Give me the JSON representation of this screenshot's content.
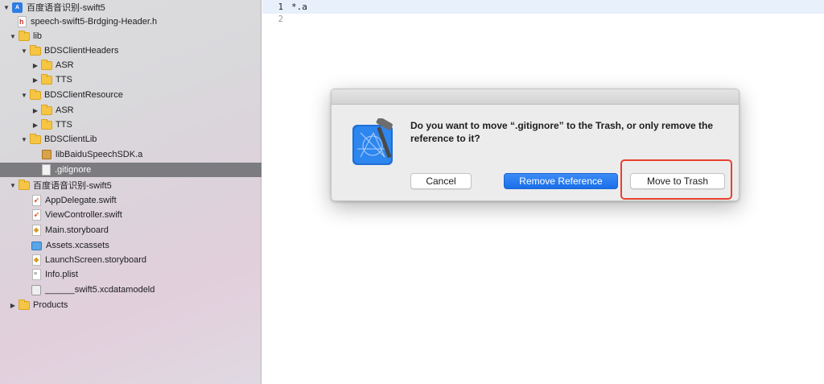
{
  "navigator": {
    "items": [
      {
        "label": "百度语音识别-swift5",
        "icon": "project-icon",
        "disclosure": "expanded"
      },
      {
        "label": "speech-swift5-Brdging-Header.h",
        "icon": "header-file-icon",
        "disclosure": "none"
      },
      {
        "label": "lib",
        "icon": "folder-icon",
        "disclosure": "expanded"
      },
      {
        "label": "BDSClientHeaders",
        "icon": "folder-icon",
        "disclosure": "expanded"
      },
      {
        "label": "ASR",
        "icon": "folder-icon",
        "disclosure": "collapsed"
      },
      {
        "label": "TTS",
        "icon": "folder-icon",
        "disclosure": "collapsed"
      },
      {
        "label": "BDSClientResource",
        "icon": "folder-icon",
        "disclosure": "expanded"
      },
      {
        "label": "ASR",
        "icon": "folder-icon",
        "disclosure": "collapsed"
      },
      {
        "label": "TTS",
        "icon": "folder-icon",
        "disclosure": "collapsed"
      },
      {
        "label": "BDSClientLib",
        "icon": "folder-icon",
        "disclosure": "expanded"
      },
      {
        "label": "libBaiduSpeechSDK.a",
        "icon": "library-icon",
        "disclosure": "none"
      },
      {
        "label": ".gitignore",
        "icon": "text-file-icon",
        "disclosure": "none",
        "selected": true
      },
      {
        "label": "百度语音识别-swift5",
        "icon": "folder-icon",
        "disclosure": "expanded"
      },
      {
        "label": "AppDelegate.swift",
        "icon": "swift-file-icon",
        "disclosure": "none"
      },
      {
        "label": "ViewController.swift",
        "icon": "swift-file-icon",
        "disclosure": "none"
      },
      {
        "label": "Main.storyboard",
        "icon": "storyboard-file-icon",
        "disclosure": "none"
      },
      {
        "label": "Assets.xcassets",
        "icon": "assets-catalog-icon",
        "disclosure": "none"
      },
      {
        "label": "LaunchScreen.storyboard",
        "icon": "storyboard-file-icon",
        "disclosure": "none"
      },
      {
        "label": "Info.plist",
        "icon": "plist-file-icon",
        "disclosure": "none"
      },
      {
        "label": "______swift5.xcdatamodeld",
        "icon": "data-model-icon",
        "disclosure": "none"
      },
      {
        "label": "Products",
        "icon": "folder-icon",
        "disclosure": "collapsed"
      }
    ]
  },
  "editor": {
    "lines": [
      {
        "number": "1",
        "text": "*.a"
      },
      {
        "number": "2",
        "text": ""
      }
    ]
  },
  "dialog": {
    "message": "Do you want to move “.gitignore” to the Trash, or only remove the reference to it?",
    "icon": "xcode-app-icon",
    "buttons": {
      "cancel": "Cancel",
      "remove_reference": "Remove Reference",
      "move_to_trash": "Move to Trash"
    }
  },
  "colors": {
    "highlight": "#e8402e",
    "primary_button": "#1a6ee8",
    "selection": "#7b7b80"
  }
}
